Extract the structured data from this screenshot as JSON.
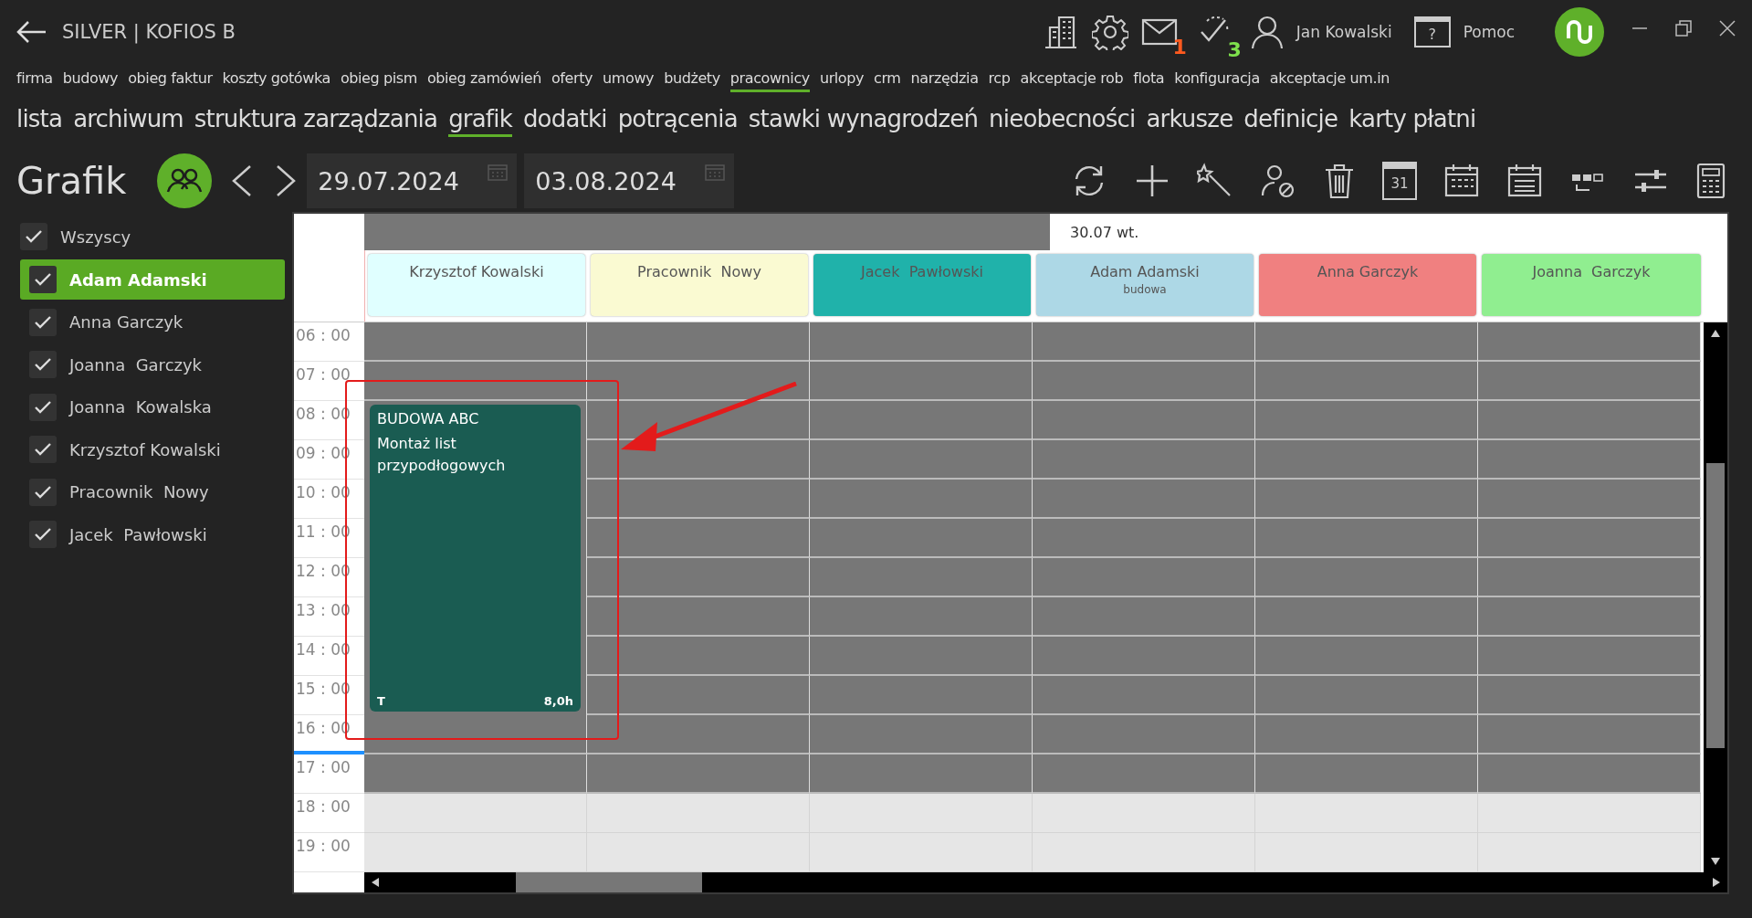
{
  "window": {
    "title": "SILVER | KOFIOS B",
    "user": "Jan Kowalski",
    "help": "Pomoc",
    "help_icon_glyph": "?",
    "mail_badge": "1",
    "tasks_badge": "3"
  },
  "nav_primary": [
    {
      "label": "firma",
      "selected": false
    },
    {
      "label": "budowy",
      "selected": false
    },
    {
      "label": "obieg faktur",
      "selected": false
    },
    {
      "label": "koszty gotówka",
      "selected": false
    },
    {
      "label": "obieg pism",
      "selected": false
    },
    {
      "label": "obieg zamówień",
      "selected": false
    },
    {
      "label": "oferty",
      "selected": false
    },
    {
      "label": "umowy",
      "selected": false
    },
    {
      "label": "budżety",
      "selected": false
    },
    {
      "label": "pracownicy",
      "selected": true
    },
    {
      "label": "urlopy",
      "selected": false
    },
    {
      "label": "crm",
      "selected": false
    },
    {
      "label": "narzędzia",
      "selected": false
    },
    {
      "label": "rcp",
      "selected": false
    },
    {
      "label": "akceptacje rob",
      "selected": false
    },
    {
      "label": "flota",
      "selected": false
    },
    {
      "label": "konfiguracja",
      "selected": false
    },
    {
      "label": "akceptacje um.in",
      "selected": false
    }
  ],
  "nav_secondary": [
    {
      "label": "lista",
      "selected": false
    },
    {
      "label": "archiwum",
      "selected": false
    },
    {
      "label": "struktura zarządzania",
      "selected": false
    },
    {
      "label": "grafik",
      "selected": true
    },
    {
      "label": "dodatki",
      "selected": false
    },
    {
      "label": "potrącenia",
      "selected": false
    },
    {
      "label": "stawki wynagrodzeń",
      "selected": false
    },
    {
      "label": "nieobecności",
      "selected": false
    },
    {
      "label": "arkusze",
      "selected": false
    },
    {
      "label": "definicje",
      "selected": false
    },
    {
      "label": "karty płatni",
      "selected": false
    }
  ],
  "toolbar": {
    "title": "Grafik",
    "date_from": "29.07.2024",
    "date_to": "03.08.2024",
    "calendar_day": "31"
  },
  "filter": {
    "all": {
      "label": "Wszyscy",
      "checked": true
    },
    "employees": [
      {
        "name": "Adam Adamski",
        "checked": true,
        "selected": true
      },
      {
        "name": "Anna Garczyk",
        "checked": true,
        "selected": false
      },
      {
        "name": "Joanna  Garczyk",
        "checked": true,
        "selected": false
      },
      {
        "name": "Joanna  Kowalska",
        "checked": true,
        "selected": false
      },
      {
        "name": "Krzysztof Kowalski",
        "checked": true,
        "selected": false
      },
      {
        "name": "Pracownik  Nowy",
        "checked": true,
        "selected": false
      },
      {
        "name": "Jacek  Pawłowski",
        "checked": true,
        "selected": false
      }
    ]
  },
  "calendar": {
    "day_label": "30.07 wt.",
    "columns": [
      {
        "name": "Krzysztof Kowalski",
        "color": "#e0ffff",
        "events": [
          {
            "title": "BUDOWA ABC",
            "description": "Montaż list przypodłogowych",
            "footer_left": "T",
            "footer_right": "8,0h",
            "color": "#1a5c52"
          }
        ]
      },
      {
        "name": "Pracownik  Nowy",
        "color": "#fafad2"
      },
      {
        "name": "Jacek  Pawłowski",
        "color": "#20b2aa"
      },
      {
        "name": "Adam Adamski",
        "subtitle": "budowa",
        "color": "#add8e6"
      },
      {
        "name": "Anna Garczyk",
        "color": "#f08080"
      },
      {
        "name": "Joanna  Garczyk",
        "color": "#90ee90"
      }
    ],
    "times": [
      {
        "label": "06 : 00",
        "off": false,
        "current": false
      },
      {
        "label": "07 : 00",
        "off": false,
        "current": false
      },
      {
        "label": "08 : 00",
        "off": false,
        "current": false
      },
      {
        "label": "09 : 00",
        "off": false,
        "current": false
      },
      {
        "label": "10 : 00",
        "off": false,
        "current": false
      },
      {
        "label": "11 : 00",
        "off": false,
        "current": false
      },
      {
        "label": "12 : 00",
        "off": false,
        "current": false
      },
      {
        "label": "13 : 00",
        "off": false,
        "current": false
      },
      {
        "label": "14 : 00",
        "off": false,
        "current": false
      },
      {
        "label": "15 : 00",
        "off": false,
        "current": false
      },
      {
        "label": "16 : 00",
        "off": false,
        "current": true
      },
      {
        "label": "17 : 00",
        "off": false,
        "current": false
      },
      {
        "label": "18 : 00",
        "off": true,
        "current": false
      },
      {
        "label": "19 : 00",
        "off": true,
        "current": false
      }
    ]
  }
}
